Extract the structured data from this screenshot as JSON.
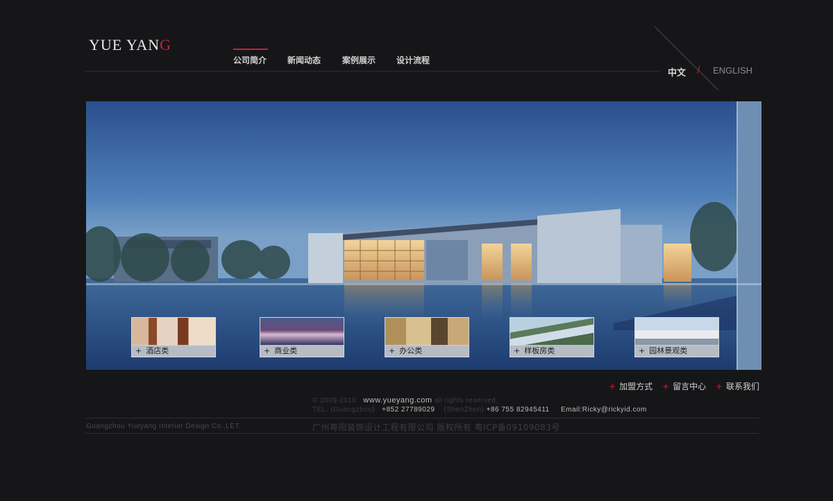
{
  "logo": {
    "text_main": "YUE YAN",
    "text_accent": "G"
  },
  "nav": {
    "items": [
      {
        "label": "公司简介",
        "active": true
      },
      {
        "label": "新闻动态"
      },
      {
        "label": "案例展示"
      },
      {
        "label": "设计流程"
      }
    ]
  },
  "lang": {
    "zh": "中文",
    "divider": "/",
    "en": "ENGLISH"
  },
  "thumbnails": [
    {
      "label": "酒店类"
    },
    {
      "label": "商业类"
    },
    {
      "label": "办公类"
    },
    {
      "label": "样板房类"
    },
    {
      "label": "园林景观类"
    }
  ],
  "footer_links": [
    "加盟方式",
    "留言中心",
    "联系我们"
  ],
  "footer": {
    "copyright": "© 2009-2010",
    "website": "www.yueyang.com",
    "rights": "all rights reserved.",
    "tel_label": "TEL: (Guangzhou)",
    "tel_gz": "+852 27789029",
    "sz_label": "(ShenZhen)",
    "tel_sz": "+86 755 82945411",
    "email": "Email:Ricky@rickyid.com",
    "company_en": "Guangzhou Yueyang Interior Design Co.,LET.",
    "company_cn": "广州粤阳装饰设计工程有限公司 版权所有 粤ICP备09109083号"
  },
  "colors": {
    "accent": "#c8203a",
    "background": "#161618"
  },
  "icons": {
    "plus": "+"
  }
}
